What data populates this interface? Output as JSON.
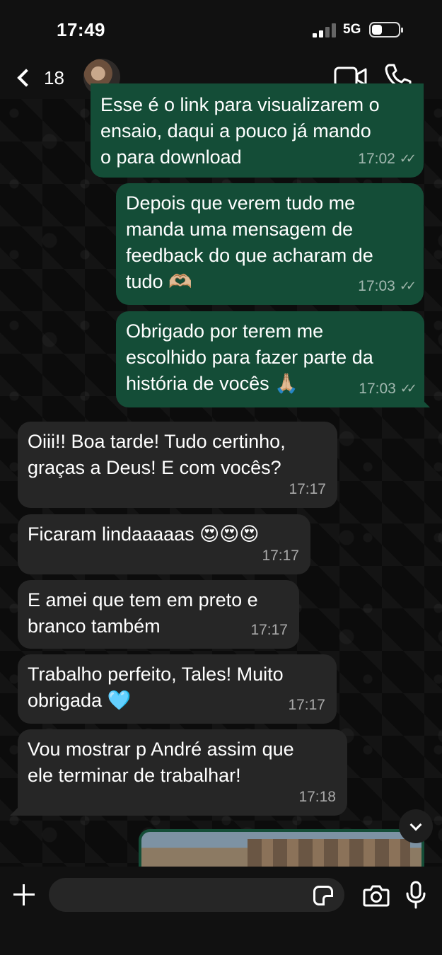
{
  "status_bar": {
    "time": "17:49",
    "network": "5G"
  },
  "header": {
    "unread_count": "18",
    "back_icon": "chevron-left-icon",
    "video_icon": "video-camera-icon",
    "phone_icon": "phone-icon"
  },
  "messages": [
    {
      "direction": "out",
      "text": "Esse é o link para visualizarem o\nensaio, daqui a pouco já mando\no para download",
      "time": "17:02",
      "read": true
    },
    {
      "direction": "out",
      "text": "Depois que verem tudo me\nmanda uma mensagem de\nfeedback do que acharam de\ntudo 🫶🏼",
      "time": "17:03",
      "read": true
    },
    {
      "direction": "out",
      "text": "Obrigado por terem me\nescolhido para fazer parte da\nhistória de vocês 🙏🏼",
      "time": "17:03",
      "read": true
    },
    {
      "direction": "in",
      "text": "Oiii!! Boa tarde! Tudo certinho,\ngraças a Deus! E com vocês?",
      "time": "17:17"
    },
    {
      "direction": "in",
      "text": "Ficaram lindaaaaas 😍😍😍",
      "time": "17:17"
    },
    {
      "direction": "in",
      "text": "E amei que tem em preto e\nbranco também",
      "time": "17:17"
    },
    {
      "direction": "in",
      "text": "Trabalho perfeito, Tales! Muito\nobrigada 🩵",
      "time": "17:17"
    },
    {
      "direction": "in",
      "text": "Vou mostrar p André assim que\nele terminar de trabalhar!",
      "time": "17:18"
    }
  ],
  "input": {
    "value": "",
    "placeholder": ""
  },
  "colors": {
    "outgoing_bubble": "#144d37",
    "incoming_bubble": "#262626",
    "background": "#0b0b0b"
  }
}
